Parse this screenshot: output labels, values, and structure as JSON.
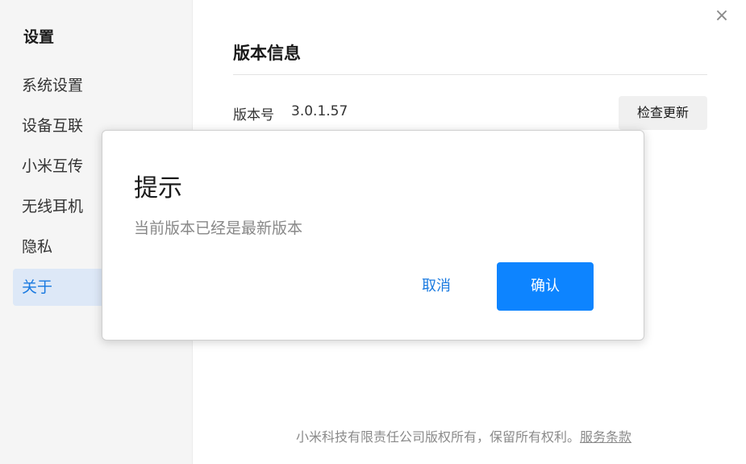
{
  "window": {
    "close_glyph": "×"
  },
  "sidebar": {
    "title": "设置",
    "items": [
      {
        "label": "系统设置",
        "active": false
      },
      {
        "label": "设备互联",
        "active": false
      },
      {
        "label": "小米互传",
        "active": false
      },
      {
        "label": "无线耳机",
        "active": false
      },
      {
        "label": "隐私",
        "active": false
      },
      {
        "label": "关于",
        "active": true
      }
    ]
  },
  "main": {
    "section_title": "版本信息",
    "version_label": "版本号",
    "version_value": "3.0.1.57",
    "check_update_label": "检查更新",
    "footer_text": "小米科技有限责任公司版权所有，保留所有权利。",
    "footer_link": "服务条款"
  },
  "dialog": {
    "title": "提示",
    "message": "当前版本已经是最新版本",
    "cancel_label": "取消",
    "confirm_label": "确认"
  },
  "colors": {
    "accent": "#0d84ff",
    "link_blue": "#1a7ae0",
    "sidebar_bg": "#f5f5f5",
    "active_item_bg": "#dde8f7"
  }
}
